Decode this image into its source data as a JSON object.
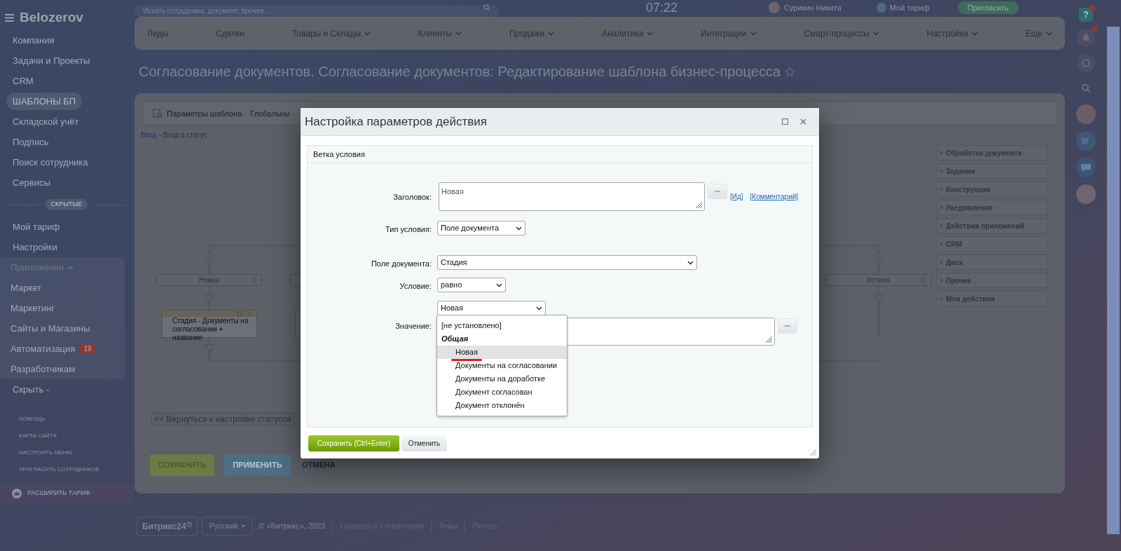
{
  "header": {
    "search_placeholder": "Искать сотрудника, документ, прочее...",
    "time": "07:22",
    "user": "Сурикин Никита",
    "plan": "Мой тариф",
    "invite": "Пригласить"
  },
  "sidebar": {
    "logo": "Belozerov",
    "items": [
      {
        "kind": "item",
        "label": "Компания",
        "selected": false
      },
      {
        "kind": "item",
        "label": "Задачи и Проекты",
        "selected": false
      },
      {
        "kind": "item",
        "label": "CRM",
        "selected": false
      },
      {
        "kind": "item",
        "label": "ШАБЛОНЫ БП",
        "selected": true
      },
      {
        "kind": "item",
        "label": "Складской учёт",
        "selected": false
      },
      {
        "kind": "item",
        "label": "Подпись",
        "selected": false
      },
      {
        "kind": "item",
        "label": "Поиск сотрудника",
        "selected": false
      },
      {
        "kind": "item",
        "label": "Сервисы",
        "selected": false
      },
      {
        "kind": "divider",
        "label": "СКРЫТЫЕ"
      },
      {
        "kind": "item",
        "label": "Мой тариф",
        "selected": false
      },
      {
        "kind": "item",
        "label": "Настройки",
        "selected": false
      },
      {
        "kind": "group",
        "label": "Приложения",
        "expanded": true,
        "children": [
          {
            "label": "Маркет",
            "selected": false
          },
          {
            "label": "Маркетинг",
            "selected": false
          },
          {
            "label": "Сайты и Магазины",
            "selected": false
          },
          {
            "label": "Автоматизация",
            "selected": false,
            "badge": "19"
          },
          {
            "label": "Разработчикам",
            "selected": false
          }
        ]
      },
      {
        "kind": "item",
        "label": "Скрыть -",
        "selected": false
      }
    ],
    "footer_links": [
      "ПОМОЩЬ",
      "КАРТА САЙТА",
      "НАСТРОИТЬ МЕНЮ",
      "ПРИГЛАСИТЬ СОТРУДНИКОВ"
    ],
    "upgrade": "РАСШИРИТЬ ТАРИФ"
  },
  "top_nav": [
    {
      "label": "Лиды",
      "dropdown": false
    },
    {
      "label": "Сделки",
      "dropdown": false
    },
    {
      "label": "Товары и Склады",
      "dropdown": true
    },
    {
      "label": "Клиенты",
      "dropdown": true
    },
    {
      "label": "Продажи",
      "dropdown": true
    },
    {
      "label": "Аналитика",
      "dropdown": true
    },
    {
      "label": "Интеграции",
      "dropdown": true
    },
    {
      "label": "Смарт-процессы",
      "dropdown": true
    },
    {
      "label": "Настройки",
      "dropdown": true
    },
    {
      "label": "Еще",
      "dropdown": true
    }
  ],
  "page_title": "Согласование документов. Согласование документов: Редактирование шаблона бизнес-процесса",
  "editor": {
    "tabs": [
      "Параметры шаблона",
      "Глобальны"
    ],
    "breadcrumb": {
      "link": "Вход",
      "text": "- Вход в статус"
    },
    "branches": [
      {
        "title": "Новая",
        "activity": "Стадия - Документы на согласовании + название"
      },
      {
        "title": "Истина"
      }
    ],
    "back_button": "<< Вернуться к настройке статусов",
    "buttons": [
      {
        "kind": "save",
        "label": "СОХРАНИТЬ"
      },
      {
        "kind": "apply",
        "label": "ПРИМЕНИТЬ"
      },
      {
        "kind": "cancel",
        "label": "ОТМЕНА"
      }
    ]
  },
  "palette": [
    "Обработка документа",
    "Задания",
    "Конструкции",
    "Уведомления",
    "Действия приложений",
    "CRM",
    "Диск",
    "Прочее",
    "Мои действия"
  ],
  "dialog": {
    "title": "Настройка параметров действия",
    "section": "Ветка условия",
    "fields": [
      {
        "kind": "textarea",
        "label": "Заголовок:",
        "value": "Новая",
        "links": [
          "[Ид]",
          "[Комментарий]"
        ]
      },
      {
        "kind": "select",
        "label": "Тип условия:",
        "value": "Поле документа"
      },
      {
        "kind": "select",
        "label": "Поле документа:",
        "value": "Стадия"
      },
      {
        "kind": "select",
        "label": "Условие:",
        "value": "равно"
      },
      {
        "kind": "value",
        "label": "Значение:",
        "value": "Новая",
        "options": [
          {
            "kind": "option",
            "label": "[не установлено]",
            "selected": false,
            "underlined": false
          },
          {
            "kind": "group",
            "label": "Общая",
            "children": [
              {
                "kind": "option",
                "label": "Новая",
                "selected": true,
                "underlined": true
              },
              {
                "kind": "option",
                "label": "Документы на согласовании",
                "selected": false,
                "underlined": false
              },
              {
                "kind": "option",
                "label": "Документы на доработке",
                "selected": false,
                "underlined": false
              },
              {
                "kind": "option",
                "label": "Документ согласован",
                "selected": false,
                "underlined": false
              },
              {
                "kind": "option",
                "label": "Документ отклонён",
                "selected": false,
                "underlined": false
              }
            ]
          }
        ]
      }
    ],
    "buttons": [
      {
        "kind": "primary",
        "label": "Сохранить (Ctrl+Enter)"
      },
      {
        "kind": "secondary",
        "label": "Отменить"
      }
    ]
  },
  "right_bar": {
    "help_label": "?",
    "avatar_initials": "ВГ"
  },
  "footer": {
    "brand": "Битрикс24",
    "language": "Русский",
    "copyright": "© «Битрикс», 2023",
    "links": [
      "Связаться с партнером",
      "Темы",
      "Печать"
    ]
  }
}
